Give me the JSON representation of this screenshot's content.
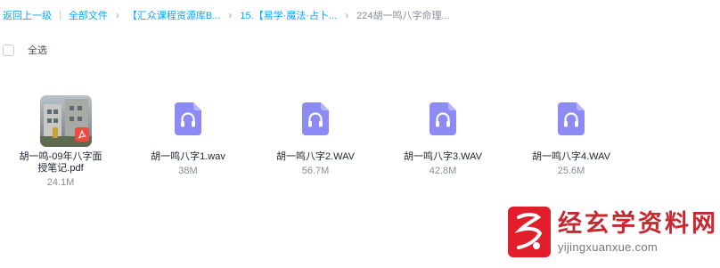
{
  "breadcrumb": {
    "back": "返回上一级",
    "all_files": "全部文件",
    "items": [
      "【汇众课程资源库B...",
      "15.【易学·魔法·占卜...",
      "224胡一鸣八字命理..."
    ]
  },
  "select_all_label": "全选",
  "files": [
    {
      "name": "胡一鸣-09年八字面授笔记.pdf",
      "size": "24.1M",
      "icon": "pdf-thumbnail"
    },
    {
      "name": "胡一鸣八字1.wav",
      "size": "38M",
      "icon": "audio-icon"
    },
    {
      "name": "胡一鸣八字2.WAV",
      "size": "56.7M",
      "icon": "audio-icon"
    },
    {
      "name": "胡一鸣八字3.WAV",
      "size": "42.8M",
      "icon": "audio-icon"
    },
    {
      "name": "胡一鸣八字4.WAV",
      "size": "25.6M",
      "icon": "audio-icon"
    }
  ],
  "watermark": {
    "title": "经玄学资料网",
    "url": "yijingxuanxue.com"
  },
  "colors": {
    "link": "#06a7ff",
    "audio_icon": "#8c8af5",
    "watermark_red": "#c8282f"
  }
}
